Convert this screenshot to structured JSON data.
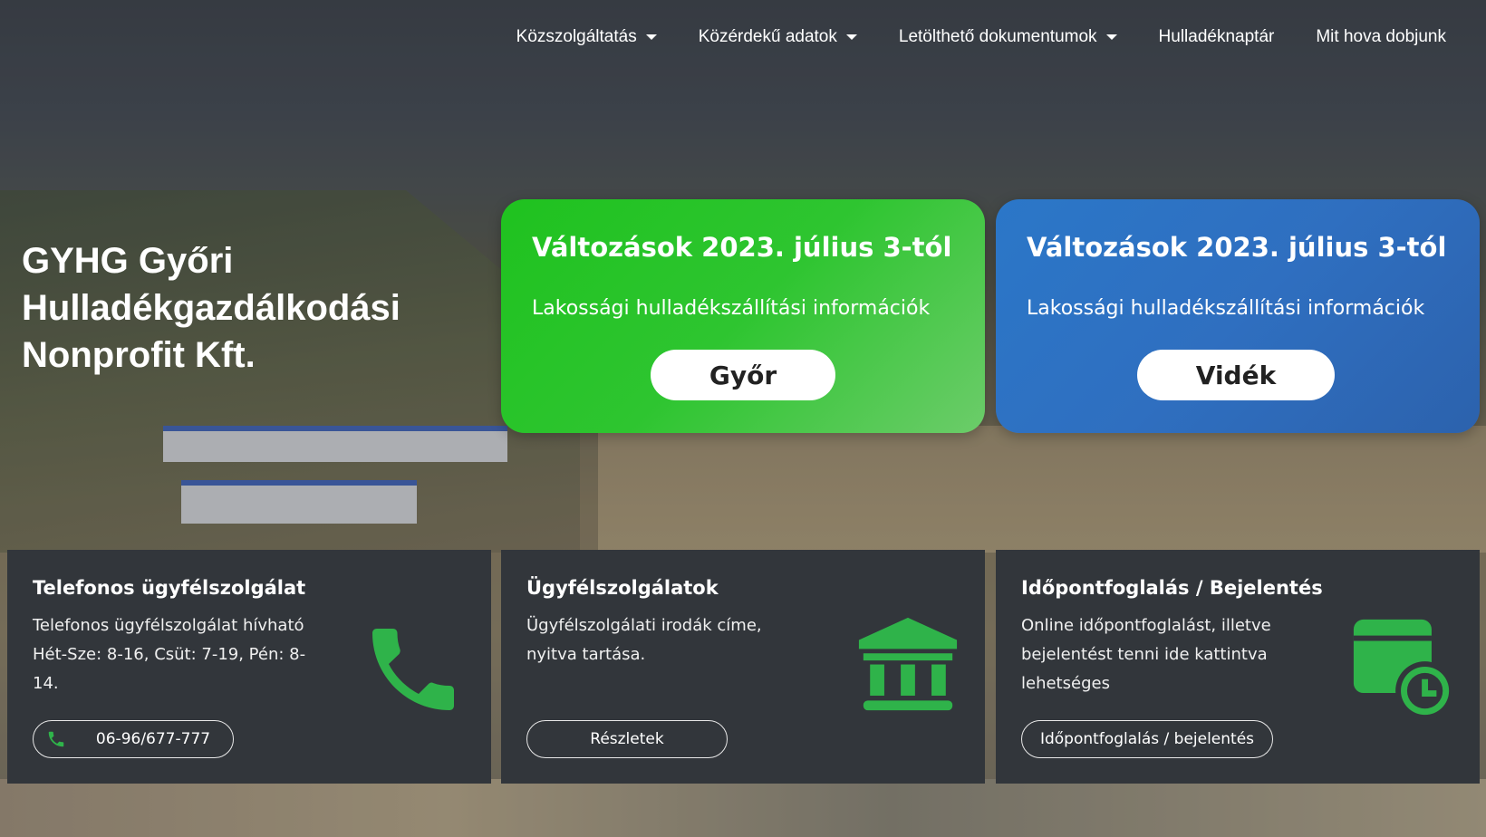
{
  "nav": {
    "items": [
      {
        "label": "Közszolgáltatás",
        "dropdown": true
      },
      {
        "label": "Közérdekű adatok",
        "dropdown": true
      },
      {
        "label": "Letölthető dokumentumok",
        "dropdown": true
      },
      {
        "label": "Hulladéknaptár",
        "dropdown": false
      },
      {
        "label": "Mit hova dobjunk",
        "dropdown": false
      }
    ]
  },
  "hero": {
    "title_strong": "GYHG",
    "title_rest": " Győri Hulladékgazdálkodási Nonprofit Kft."
  },
  "cards": {
    "green": {
      "title": "Változások 2023. július 3-tól",
      "subtitle": "Lakossági hulladékszállítási információk",
      "button": "Győr",
      "color": "#22c322"
    },
    "blue": {
      "title": "Változások 2023. július 3-tól",
      "subtitle": "Lakossági hulladékszállítási információk",
      "button": "Vidék",
      "color": "#2b6fbf"
    }
  },
  "info": {
    "phone": {
      "title": "Telefonos ügyfélszolgálat",
      "text": "Telefonos ügyfélszolgálat hívható Hét-Sze: 8-16, Csüt: 7-19, Pén: 8-14.",
      "button": "06-96/677-777",
      "icon": "phone-icon"
    },
    "offices": {
      "title": "Ügyfélszolgálatok",
      "text": "Ügyfélszolgálati irodák címe, nyitva tartása.",
      "button": "Részletek",
      "icon": "bank-icon"
    },
    "booking": {
      "title": "Időpontfoglalás / Bejelentés",
      "text": "Online időpontfoglalást, illetve bejelentést tenni ide kattintva lehetséges",
      "button": "Időpontfoglalás / bejelentés",
      "icon": "calendar-clock-icon"
    },
    "icon_color": "#2fb34a"
  }
}
